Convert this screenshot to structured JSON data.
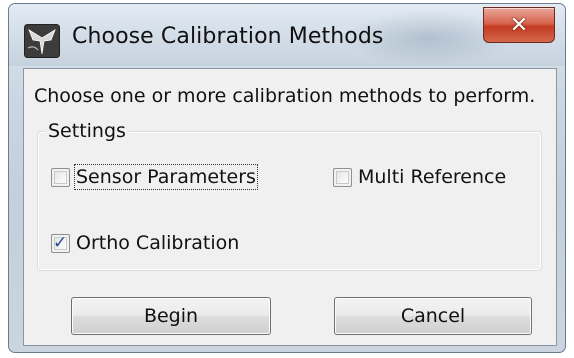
{
  "window": {
    "title": "Choose Calibration Methods",
    "close_glyph": "✕",
    "icon": "app-calibration-icon"
  },
  "instruction": "Choose one or more calibration methods to perform.",
  "settings": {
    "label": "Settings",
    "options": [
      {
        "label": "Sensor Parameters",
        "checked": false,
        "focused": true
      },
      {
        "label": "Multi Reference",
        "checked": false,
        "focused": false
      },
      {
        "label": "Ortho Calibration",
        "checked": true,
        "focused": false
      }
    ],
    "check_glyph": "✓"
  },
  "buttons": {
    "begin": "Begin",
    "cancel": "Cancel"
  }
}
